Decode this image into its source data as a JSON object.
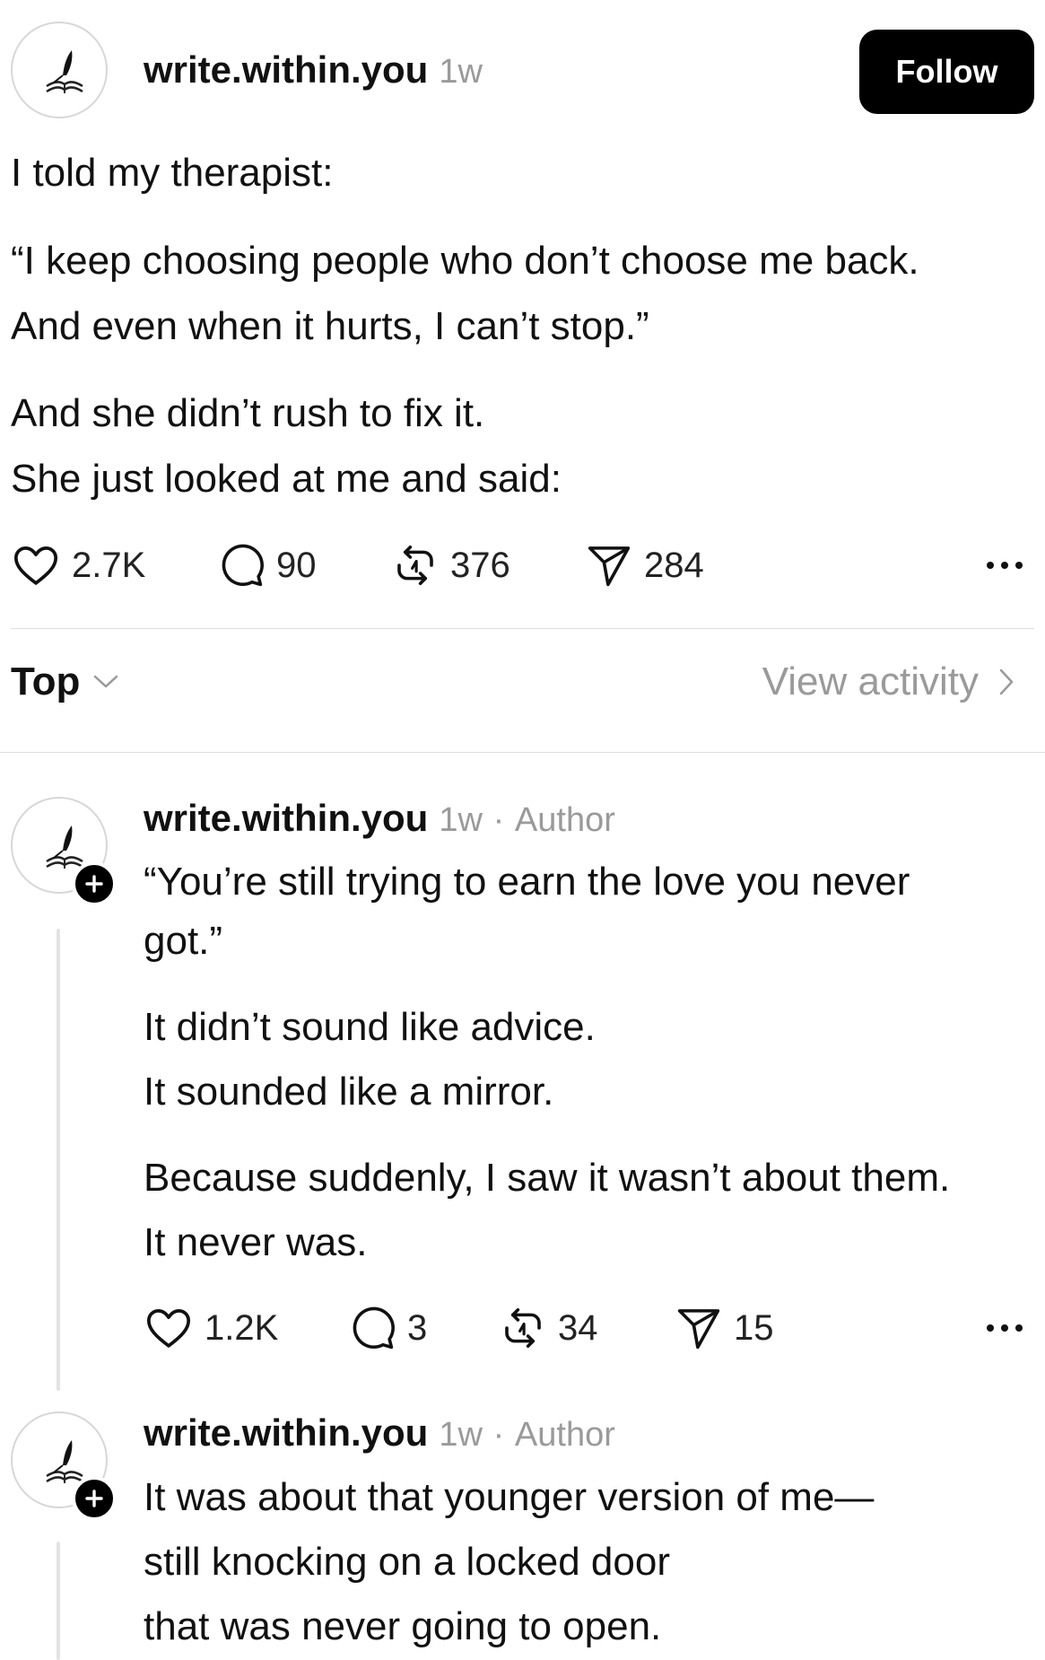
{
  "post": {
    "username": "write.within.you",
    "time": "1w",
    "follow_label": "Follow",
    "lines": [
      "I told my therapist:",
      "“I keep choosing people who don’t choose me back.",
      "And even when it hurts, I can’t stop.”",
      "And she didn’t rush to fix it.",
      "She just looked at me and said:"
    ],
    "stats": {
      "likes": "2.7K",
      "comments": "90",
      "reposts": "376",
      "shares": "284"
    }
  },
  "sort": {
    "label": "Top",
    "view_activity": "View activity"
  },
  "replies": [
    {
      "username": "write.within.you",
      "time": "1w",
      "separator": "·",
      "tag": "Author",
      "lines": [
        "“You’re still trying to earn the love you never",
        "got.”",
        "It didn’t sound like advice.",
        "It sounded like a mirror.",
        "Because suddenly, I saw it wasn’t about them.",
        "It never was."
      ],
      "stats": {
        "likes": "1.2K",
        "comments": "3",
        "reposts": "34",
        "shares": "15"
      }
    },
    {
      "username": "write.within.you",
      "time": "1w",
      "separator": "·",
      "tag": "Author",
      "lines": [
        "It was about that younger version of me—",
        "still knocking on a locked door",
        "that was never going to open."
      ]
    }
  ],
  "icons": {
    "avatar": "quill-and-book-icon",
    "like": "heart-icon",
    "comment": "comment-bubble-icon",
    "repost": "repost-arrows-icon",
    "share": "paper-plane-icon",
    "more": "more-dots-icon",
    "sort": "chevron-down-icon",
    "activity": "chevron-right-icon",
    "badge": "plus-icon"
  },
  "colors": {
    "text": "#111111",
    "muted": "#9a9a9a",
    "button_bg": "#000000",
    "divider": "#dedede"
  }
}
